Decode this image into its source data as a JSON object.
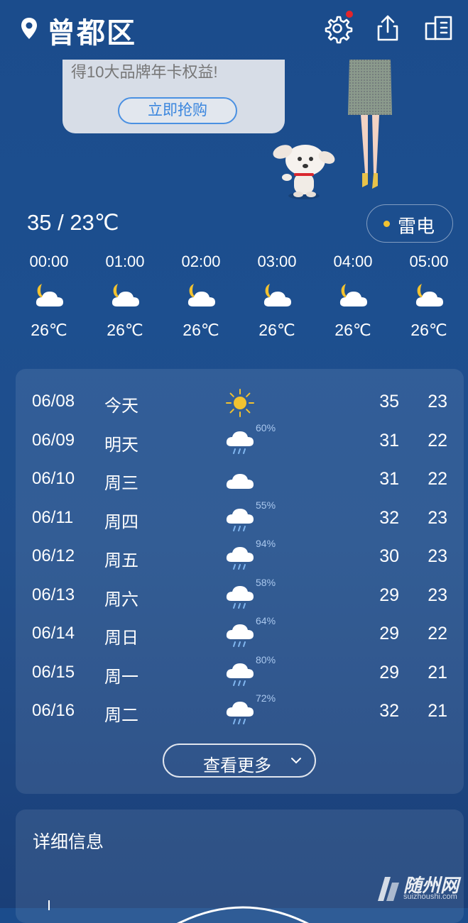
{
  "header": {
    "location": "曾都区",
    "icons": [
      "location-pin-icon",
      "settings-icon",
      "share-icon",
      "city-manage-icon"
    ],
    "notification_color": "#e4252b"
  },
  "ad": {
    "text": "得10大品牌年卡权益!",
    "button": "立即抢购"
  },
  "today": {
    "temp_range": "35 / 23℃",
    "condition": "雷电",
    "condition_dot_color": "#f2c230"
  },
  "hourly": [
    {
      "time": "00:00",
      "icon": "partly-cloudy-night-icon",
      "temp": "26℃"
    },
    {
      "time": "01:00",
      "icon": "partly-cloudy-night-icon",
      "temp": "26℃"
    },
    {
      "time": "02:00",
      "icon": "partly-cloudy-night-icon",
      "temp": "26℃"
    },
    {
      "time": "03:00",
      "icon": "partly-cloudy-night-icon",
      "temp": "26℃"
    },
    {
      "time": "04:00",
      "icon": "partly-cloudy-night-icon",
      "temp": "26℃"
    },
    {
      "time": "05:00",
      "icon": "partly-cloudy-night-icon",
      "temp": "26℃"
    }
  ],
  "forecast": [
    {
      "date": "06/08",
      "day": "今天",
      "icon": "sunny-icon",
      "pop": "",
      "high": "35",
      "low": "23"
    },
    {
      "date": "06/09",
      "day": "明天",
      "icon": "rain-icon",
      "pop": "60%",
      "high": "31",
      "low": "22"
    },
    {
      "date": "06/10",
      "day": "周三",
      "icon": "cloudy-icon",
      "pop": "",
      "high": "31",
      "low": "22"
    },
    {
      "date": "06/11",
      "day": "周四",
      "icon": "rain-icon",
      "pop": "55%",
      "high": "32",
      "low": "23"
    },
    {
      "date": "06/12",
      "day": "周五",
      "icon": "rain-icon",
      "pop": "94%",
      "high": "30",
      "low": "23"
    },
    {
      "date": "06/13",
      "day": "周六",
      "icon": "rain-icon",
      "pop": "58%",
      "high": "29",
      "low": "23"
    },
    {
      "date": "06/14",
      "day": "周日",
      "icon": "rain-icon",
      "pop": "64%",
      "high": "29",
      "low": "22"
    },
    {
      "date": "06/15",
      "day": "周一",
      "icon": "rain-icon",
      "pop": "80%",
      "high": "29",
      "low": "21"
    },
    {
      "date": "06/16",
      "day": "周二",
      "icon": "rain-icon",
      "pop": "72%",
      "high": "32",
      "low": "21"
    }
  ],
  "more_button": "查看更多",
  "detail": {
    "title": "详细信息"
  },
  "watermark": {
    "main": "随州网",
    "sub": "suizhoushi.com"
  }
}
